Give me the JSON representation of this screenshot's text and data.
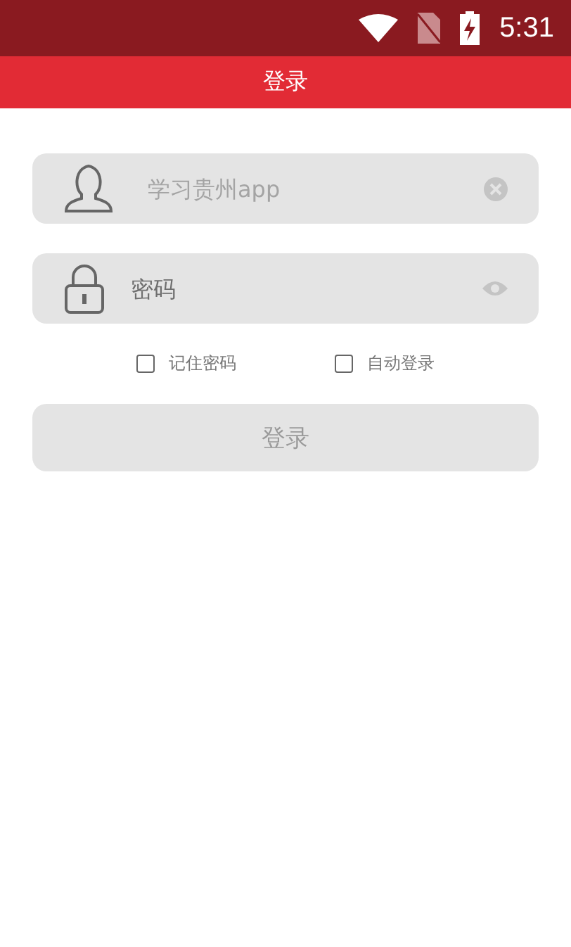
{
  "status_bar": {
    "time": "5:31"
  },
  "app_bar": {
    "title": "登录"
  },
  "username": {
    "placeholder": "学习贵州app"
  },
  "password": {
    "placeholder": "密码"
  },
  "options": [
    {
      "label": "记住密码",
      "checked": false
    },
    {
      "label": "自动登录",
      "checked": false
    }
  ],
  "login_button": {
    "label": "登录",
    "disabled": true
  }
}
